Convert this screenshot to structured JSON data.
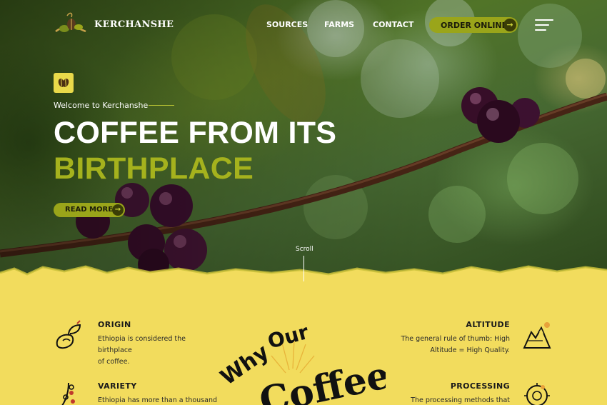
{
  "brand": {
    "name": "KERCHANSHE"
  },
  "nav": {
    "items": [
      {
        "label": "SOURCES"
      },
      {
        "label": "FARMS"
      },
      {
        "label": "CONTACT"
      }
    ],
    "order_label": "ORDER ONLINE",
    "order_arrow": "→"
  },
  "hero": {
    "welcome": "Welcome to Kerchanshe",
    "title_line1": "COFFEE FROM ITS",
    "title_line2": "BIRTHPLACE",
    "read_more": "READ MORE",
    "read_more_arrow": "→",
    "scroll": "Scroll"
  },
  "features": {
    "origin": {
      "title": "ORIGIN",
      "text_line1": "Ethiopia is considered the birthplace",
      "text_line2": "of coffee."
    },
    "variety": {
      "title": "VARIETY",
      "text_line1": "Ethiopia has more than a thousand"
    },
    "altitude": {
      "title": "ALTITUDE",
      "text_line1": "The general rule of thumb: High",
      "text_line2": "Altitude = High Quality."
    },
    "processing": {
      "title": "PROCESSING",
      "text_line1": "The processing methods that we"
    }
  },
  "why": {
    "word1": "Why",
    "word2": "Our",
    "word3": "Coffee"
  },
  "colors": {
    "accent": "#9aa51a",
    "yellow": "#f2dc5d",
    "headline_green": "#a5b21d"
  }
}
